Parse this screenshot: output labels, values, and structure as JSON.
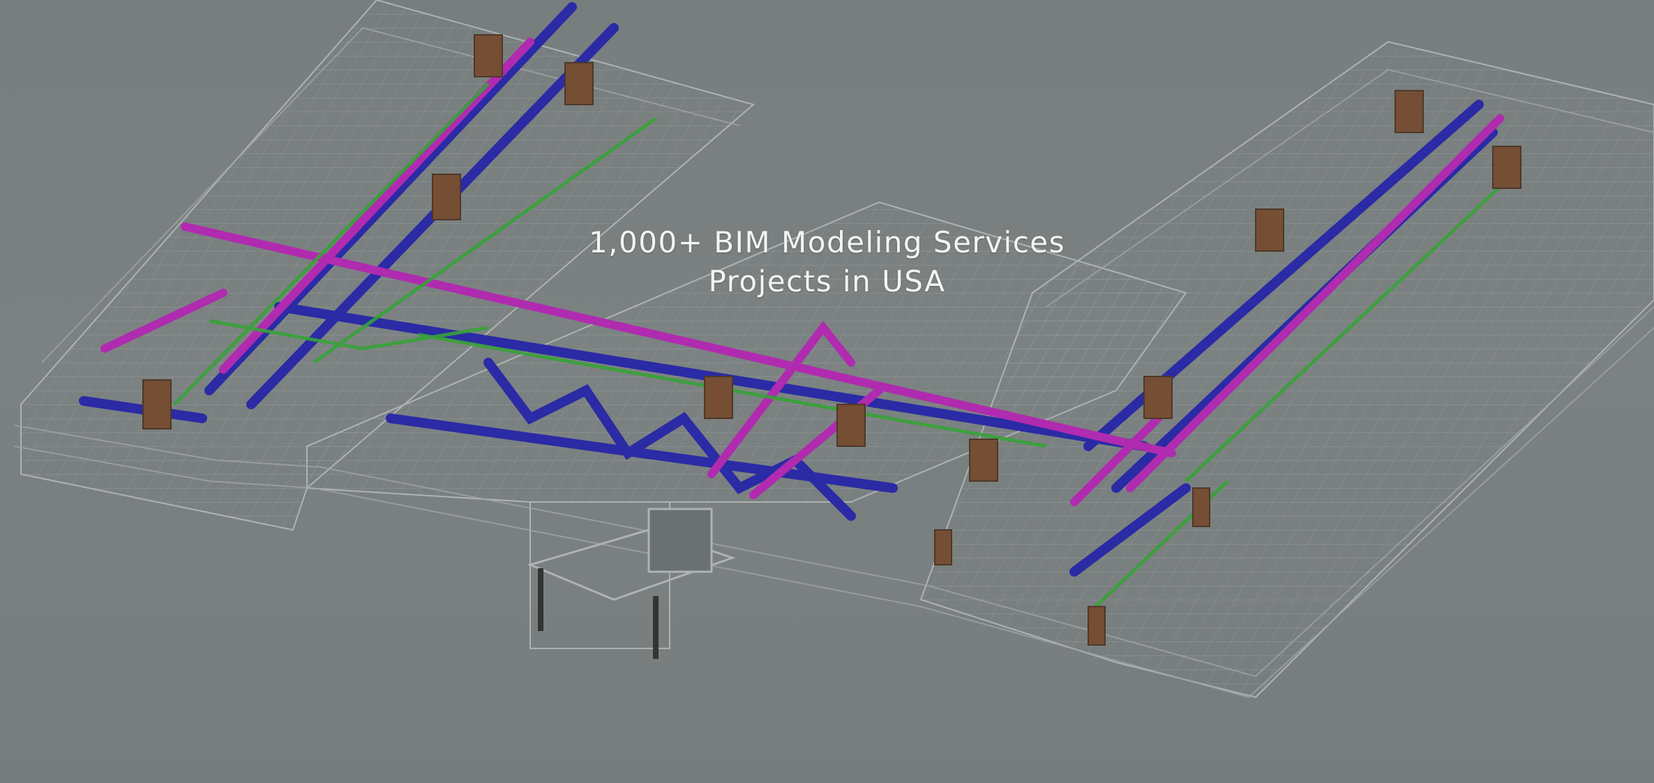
{
  "hero": {
    "headline_line1": "1,000+ BIM Modeling Services",
    "headline_line2": "Projects in USA",
    "image_subject": "isometric-building-mep-model"
  },
  "colors": {
    "background": "#7f8585",
    "building_lines": "#c8cdcd",
    "duct_blue": "#1f1fb4",
    "pipe_magenta": "#c21fc0",
    "pipe_green": "#2fb02f",
    "equipment_brown": "#7a4a2a",
    "headline_text": "#f4f4f4"
  }
}
